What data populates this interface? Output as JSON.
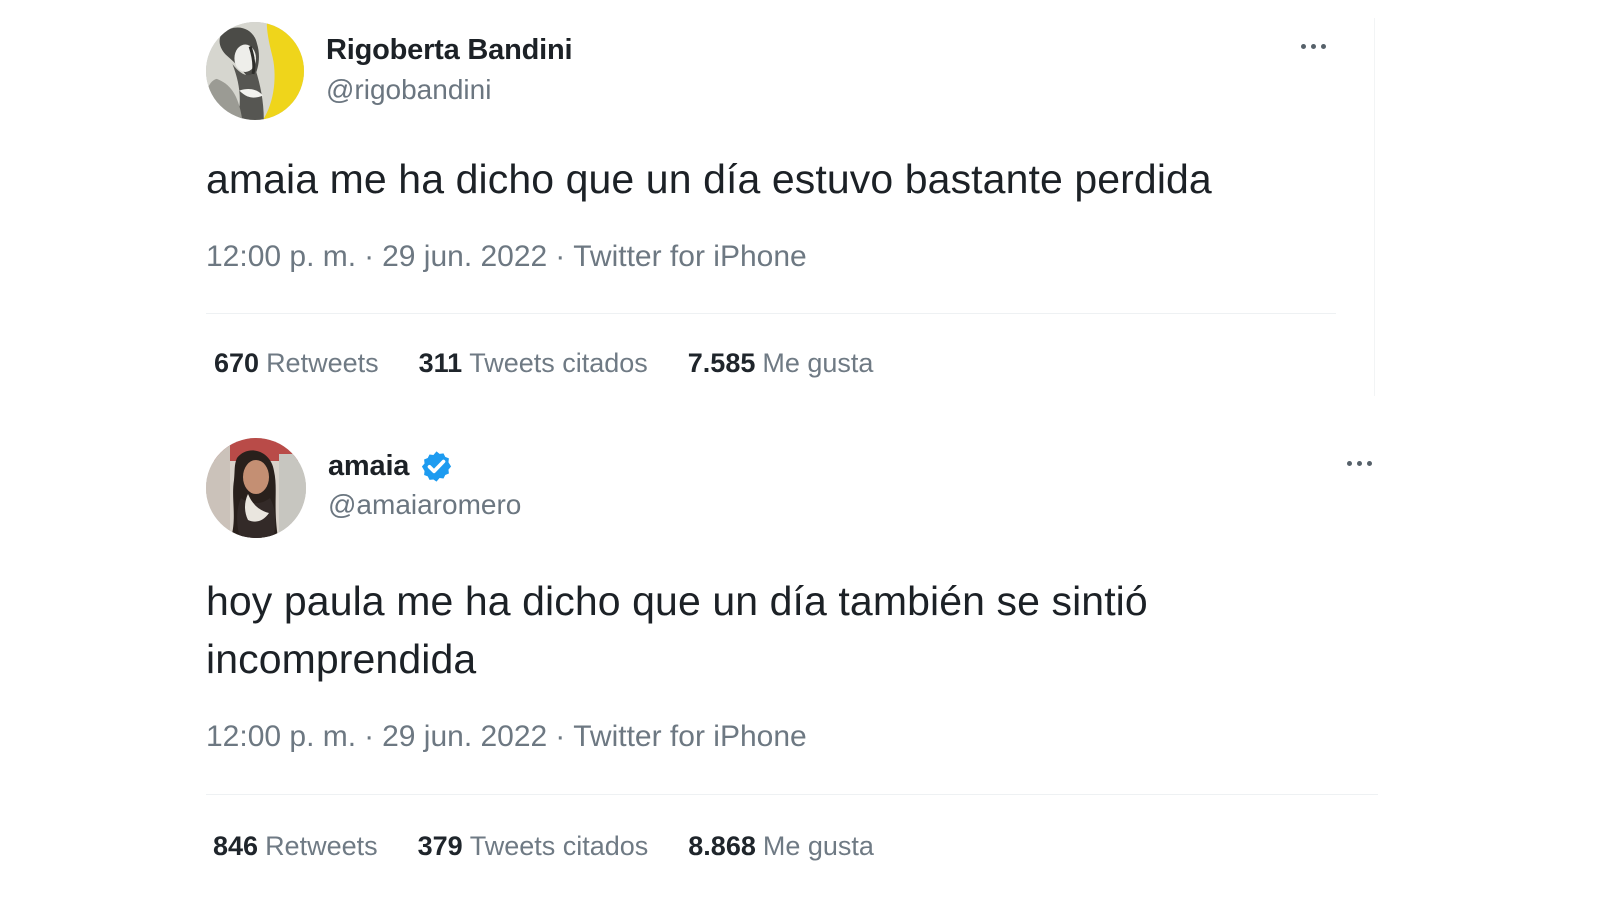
{
  "colors": {
    "background": "#ffffff",
    "primary_text": "#1c2126",
    "secondary_text": "#6d7882",
    "verified_blue": "#1d9bf0"
  },
  "tweets": [
    {
      "author": {
        "name": "Rigoberta Bandini",
        "handle": "@rigobandini",
        "verified": false,
        "avatar_icon": "profile-photo"
      },
      "text": "amaia me ha dicho que un día estuvo bastante perdida",
      "meta": {
        "time": "12:00 p. m.",
        "separator_1": "·",
        "date": "29 jun. 2022",
        "separator_2": "·",
        "source": "Twitter for iPhone"
      },
      "stats": [
        {
          "value": "670",
          "label": "Retweets"
        },
        {
          "value": "311",
          "label": "Tweets citados"
        },
        {
          "value": "7.585",
          "label": "Me gusta"
        }
      ],
      "more_icon": "more-horizontal"
    },
    {
      "author": {
        "name": "amaia",
        "handle": "@amaiaromero",
        "verified": true,
        "avatar_icon": "profile-photo"
      },
      "text": "hoy paula me ha dicho que un día también se sintió\nincomprendida",
      "meta": {
        "time": "12:00 p. m.",
        "separator_1": "·",
        "date": "29 jun. 2022",
        "separator_2": "·",
        "source": "Twitter for iPhone"
      },
      "stats": [
        {
          "value": "846",
          "label": "Retweets"
        },
        {
          "value": "379",
          "label": "Tweets citados"
        },
        {
          "value": "8.868",
          "label": "Me gusta"
        }
      ],
      "more_icon": "more-horizontal"
    }
  ]
}
